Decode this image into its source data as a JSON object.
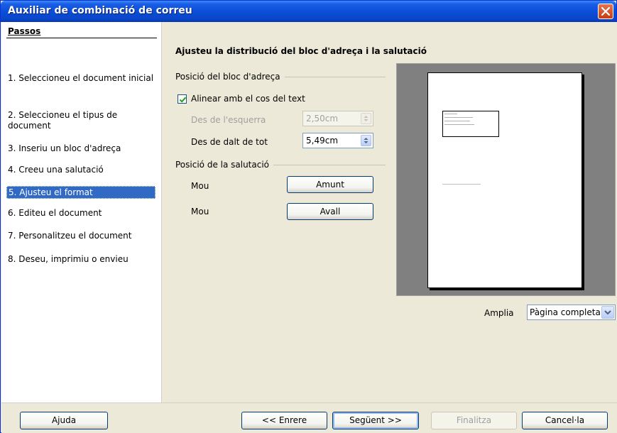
{
  "window": {
    "title": "Auxiliar de combinació de correu"
  },
  "sidebar": {
    "title": "Passos",
    "steps": [
      {
        "label": "1. Seleccioneu el document inicial"
      },
      {
        "label": "2. Seleccioneu el tipus de document"
      },
      {
        "label": "3. Inseriu un bloc d'adreça"
      },
      {
        "label": "4. Creeu una salutació"
      },
      {
        "label": "5. Ajusteu el format",
        "active": true
      },
      {
        "label": "6. Editeu el document"
      },
      {
        "label": "7. Personalitzeu el document"
      },
      {
        "label": "8. Deseu, imprimiu o envieu"
      }
    ]
  },
  "main": {
    "heading": "Ajusteu la distribució del bloc d'adreça i la salutació",
    "address_group": {
      "label": "Posició del bloc d'adreça",
      "align_checkbox": {
        "label": "Alinear amb el cos del text",
        "checked": true
      },
      "from_left": {
        "label": "Des de l'esquerra",
        "value": "2,50cm",
        "enabled": false
      },
      "from_top": {
        "label": "Des de dalt de tot",
        "value": "5,49cm",
        "enabled": true
      }
    },
    "salutation_group": {
      "label": "Posició de la salutació",
      "move_up_label": "Mou",
      "move_up_button": "Amunt",
      "move_down_label": "Mou",
      "move_down_button": "Avall"
    },
    "zoom": {
      "label": "Amplia",
      "value": "Pàgina completa"
    }
  },
  "buttons": {
    "help": "Ajuda",
    "back": "<< Enrere",
    "next": "Següent >>",
    "finish": "Finalitza",
    "cancel": "Cancel·la"
  }
}
